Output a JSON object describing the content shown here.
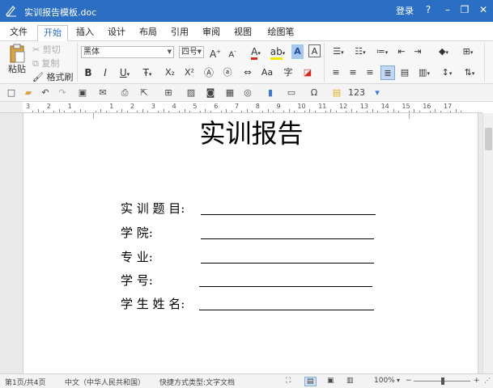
{
  "window": {
    "title": "实训报告模板.doc",
    "login": "登录",
    "help": "?",
    "minimize": "–",
    "restore": "❐",
    "close": "✕"
  },
  "tabs": [
    {
      "label": "文件"
    },
    {
      "label": "开始"
    },
    {
      "label": "插入"
    },
    {
      "label": "设计"
    },
    {
      "label": "布局"
    },
    {
      "label": "引用"
    },
    {
      "label": "审阅"
    },
    {
      "label": "视图"
    },
    {
      "label": "绘图笔"
    }
  ],
  "ribbon": {
    "paste": "粘贴",
    "cut": "剪切",
    "copy": "复制",
    "format_painter": "格式刷",
    "font_name": "黑体",
    "font_size": "四号",
    "grow": "A",
    "shrink": "A",
    "bold": "B",
    "italic": "I",
    "underline": "U",
    "strike": "Ŧ",
    "subscript": "X₂",
    "superscript": "X²",
    "clear_format": "Ⓐ",
    "char_border": "A",
    "char_shading": "A",
    "accent_font_color": "#d9281e",
    "accent_highlight": "#f2e600"
  },
  "document": {
    "title": "实训报告",
    "fields": [
      {
        "label": "实 训 题 目:"
      },
      {
        "label": "学        院:"
      },
      {
        "label": "专        业:"
      },
      {
        "label": "学        号:"
      },
      {
        "label": "学 生 姓 名:"
      }
    ]
  },
  "ruler": {
    "numbers": [
      "3",
      "2",
      "1",
      "",
      "1",
      "2",
      "3",
      "4",
      "5",
      "6",
      "7",
      "8",
      "9",
      "10",
      "11",
      "12",
      "13",
      "14",
      "15",
      "16",
      "17"
    ]
  },
  "status": {
    "page": "第1页/共4页",
    "language": "中文（中华人民共和国）",
    "input_mode": "快捷方式类型:文字文档",
    "zoom": "100%",
    "zoom_out": "−",
    "zoom_in": "+"
  }
}
